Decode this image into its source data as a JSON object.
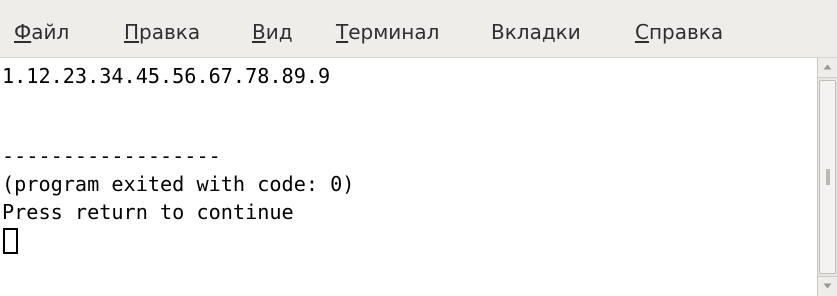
{
  "menu": {
    "items": [
      {
        "pre": "",
        "key": "Ф",
        "post": "айл"
      },
      {
        "pre": "",
        "key": "П",
        "post": "равка"
      },
      {
        "pre": "",
        "key": "В",
        "post": "ид"
      },
      {
        "pre": "",
        "key": "Т",
        "post": "ерминал"
      },
      {
        "pre": "Вкла",
        "key": "д",
        "post": "ки"
      },
      {
        "pre": "",
        "key": "С",
        "post": "правка"
      }
    ]
  },
  "terminal": {
    "lines": [
      "1.12.23.34.45.56.67.78.89.9",
      "",
      "------------------",
      "(program exited with code: 0)",
      "Press return to continue"
    ]
  },
  "icons": {
    "scroll_up": "arrow-up-icon",
    "scroll_down": "arrow-down-icon"
  }
}
